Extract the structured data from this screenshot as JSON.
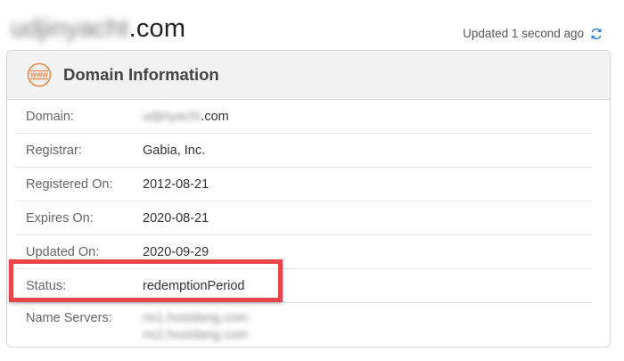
{
  "header": {
    "domain_blurred": "udjinyacht",
    "domain_suffix": ".com",
    "updated_text": "Updated 1 second ago",
    "refresh_icon": "refresh-icon"
  },
  "card": {
    "title": "Domain Information",
    "icon": "www-icon",
    "icon_text": "WWW",
    "accent_color": "#e8874a"
  },
  "rows": {
    "domain": {
      "label": "Domain:",
      "value_blurred": "udjinyacht",
      "value_suffix": ".com"
    },
    "registrar": {
      "label": "Registrar:",
      "value": "Gabia, Inc."
    },
    "registered": {
      "label": "Registered On:",
      "value": "2012-08-21"
    },
    "expires": {
      "label": "Expires On:",
      "value": "2020-08-21"
    },
    "updated": {
      "label": "Updated On:",
      "value": "2020-09-29"
    },
    "status": {
      "label": "Status:",
      "value": "redemptionPeriod"
    },
    "name_servers": {
      "label": "Name Servers:",
      "values": [
        "ns1.hostdang.com",
        "ns2.hostdang.com"
      ]
    }
  },
  "highlight_color": "#e8454a"
}
